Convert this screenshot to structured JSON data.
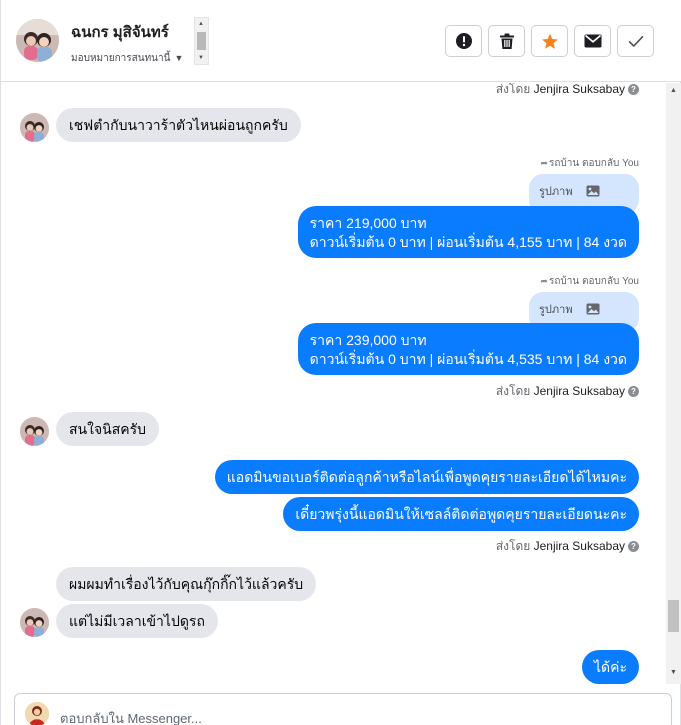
{
  "header": {
    "contact_name": "ฉนกร มุสิจันทร์",
    "assign_label": "มอบหมายการสนทนานี้",
    "buttons": {
      "spam": "exclamation-circle-icon",
      "delete": "trash-icon",
      "star": "star-icon",
      "unread": "envelope-icon",
      "done": "check-icon"
    },
    "star_color": "#f5821f"
  },
  "messages": {
    "sent_by_1": {
      "prefix": "ส่งโดย",
      "name": "Jenjira Suksabay"
    },
    "in_1": "เชฟตำกับนาวาร้าตัวไหนผ่อนถูกครับ",
    "reply_note_1": "รถบ้าน ตอบกลับ You",
    "quoted_1": "รูปภาพ",
    "out_1_line1": "ราคา 219,000 บาท",
    "out_1_line2": "ดาวน์เริ่มต้น 0 บาท | ผ่อนเริ่มต้น 4,155 บาท | 84 งวด",
    "reply_note_2": "รถบ้าน ตอบกลับ You",
    "quoted_2": "รูปภาพ",
    "out_2_line1": "ราคา 239,000 บาท",
    "out_2_line2": "ดาวน์เริ่มต้น 0 บาท | ผ่อนเริ่มต้น 4,535 บาท | 84 งวด",
    "sent_by_2": {
      "prefix": "ส่งโดย",
      "name": "Jenjira Suksabay"
    },
    "in_2": "สนใจนิสครับ",
    "out_3": "แอดมินขอเบอร์ติดต่อลูกค้าหรือไลน์เพื่อพูดคุยรายละเอียดได้ไหมคะ",
    "out_4": "เดี๋ยวพรุ่งนี้แอดมินให้เซลล์ติดต่อพูดคุยรายละเอียดนะคะ",
    "sent_by_3": {
      "prefix": "ส่งโดย",
      "name": "Jenjira Suksabay"
    },
    "in_3": "ผมผมทำเรื่องไว้กับคุณกุ๊กกิ๊กไว้แล้วครับ",
    "in_4": "แต่ไม่มีเวลาเข้าไปดูรถ",
    "out_5": "ได้ค่ะ"
  },
  "composer": {
    "placeholder": "ตอบกลับใน Messenger..."
  },
  "colors": {
    "outgoing_bubble": "#0a7cff",
    "incoming_bubble": "#e4e6eb",
    "quoted_bubble": "#d4e6fd"
  }
}
